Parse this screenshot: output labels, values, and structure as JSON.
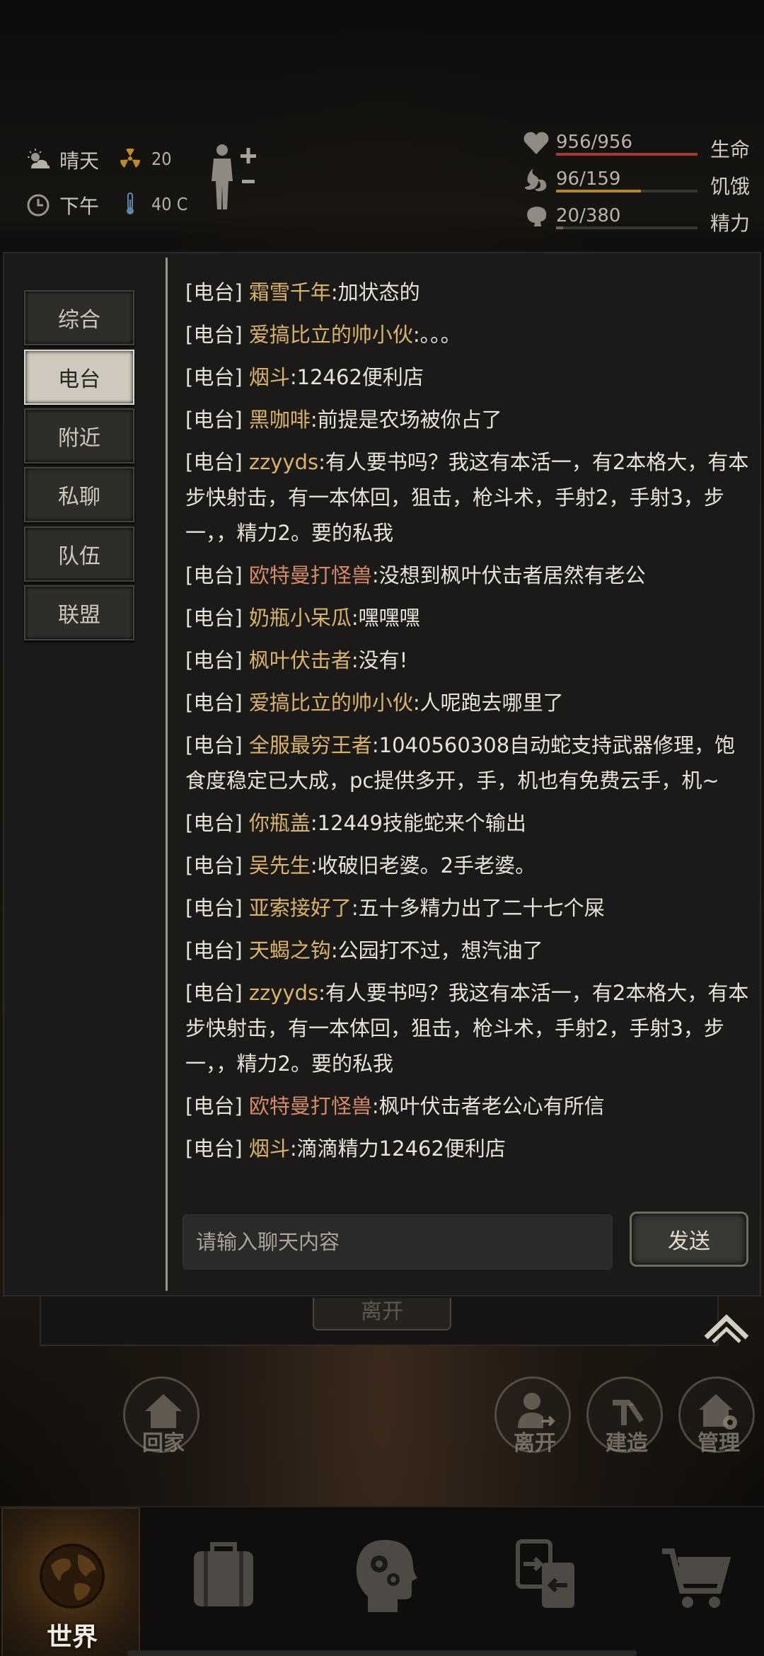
{
  "status": {
    "weather": "晴天",
    "radiation": "20",
    "time_of_day": "下午",
    "temperature": "40 C",
    "health": {
      "value": "956/956",
      "label": "生命",
      "fraction": 1.0,
      "color": "#a63a2e"
    },
    "hunger": {
      "value": "96/159",
      "label": "饥饿",
      "fraction": 0.6,
      "color": "#b8862a"
    },
    "energy": {
      "value": "20/380",
      "label": "精力",
      "fraction": 0.05,
      "color": "#6b675f"
    }
  },
  "tabs": [
    "综合",
    "电台",
    "附近",
    "私聊",
    "队伍",
    "联盟"
  ],
  "active_tab": "电台",
  "messages": [
    {
      "channel": "[电台]",
      "name": "霜雪千年",
      "text": ":加状态的",
      "tone": "gold"
    },
    {
      "channel": "[电台]",
      "name": "爱搞比立的帅小伙",
      "text": ":。。。",
      "tone": "gold"
    },
    {
      "channel": "[电台]",
      "name": "烟斗",
      "text": ":12462便利店",
      "tone": "gold"
    },
    {
      "channel": "[电台]",
      "name": "黑咖啡",
      "text": ":前提是农场被你占了",
      "tone": "gold"
    },
    {
      "channel": "[电台]",
      "name": "zzyyds",
      "text": ":有人要书吗？我这有本活一，有2本格大，有本步快射击，有一本体回，狙击，枪斗术，手射2，手射3，步一，，精力2。要的私我",
      "tone": "gold"
    },
    {
      "channel": "[电台]",
      "name": "欧特曼打怪兽",
      "text": ":没想到枫叶伏击者居然有老公",
      "tone": "red"
    },
    {
      "channel": "[电台]",
      "name": "奶瓶小呆瓜",
      "text": ":嘿嘿嘿",
      "tone": "gold"
    },
    {
      "channel": "[电台]",
      "name": "枫叶伏击者",
      "text": ":没有!",
      "tone": "gold"
    },
    {
      "channel": "[电台]",
      "name": "爱搞比立的帅小伙",
      "text": ":人呢跑去哪里了",
      "tone": "gold"
    },
    {
      "channel": "[电台]",
      "name": "全服最穷王者",
      "text": ":1040560308自动蛇支持武器修理，饱食度稳定已大成，pc提供多开，手，机也有免费云手，机~",
      "tone": "gold"
    },
    {
      "channel": "[电台]",
      "name": "你瓶盖",
      "text": ":12449技能蛇来个输出",
      "tone": "gold"
    },
    {
      "channel": "[电台]",
      "name": "吴先生",
      "text": ":收破旧老婆。2手老婆。",
      "tone": "gold"
    },
    {
      "channel": "[电台]",
      "name": "亚索接好了",
      "text": ":五十多精力出了二十七个屎",
      "tone": "gold"
    },
    {
      "channel": "[电台]",
      "name": "天蝎之钩",
      "text": ":公园打不过，想汽油了",
      "tone": "gold"
    },
    {
      "channel": "[电台]",
      "name": "zzyyds",
      "text": ":有人要书吗？我这有本活一，有2本格大，有本步快射击，有一本体回，狙击，枪斗术，手射2，手射3，步一，，精力2。要的私我",
      "tone": "gold"
    },
    {
      "channel": "[电台]",
      "name": "欧特曼打怪兽",
      "text": ":枫叶伏击者老公心有所信",
      "tone": "red"
    },
    {
      "channel": "[电台]",
      "name": "烟斗",
      "text": ":滴滴精力12462便利店",
      "tone": "gold"
    }
  ],
  "input": {
    "placeholder": "请输入聊天内容",
    "send_label": "发送"
  },
  "leave_tab_label": "离开",
  "actions": {
    "home": "回家",
    "leave": "离开",
    "build": "建造",
    "manage": "管理"
  },
  "bottom_nav": {
    "world": "世界"
  }
}
